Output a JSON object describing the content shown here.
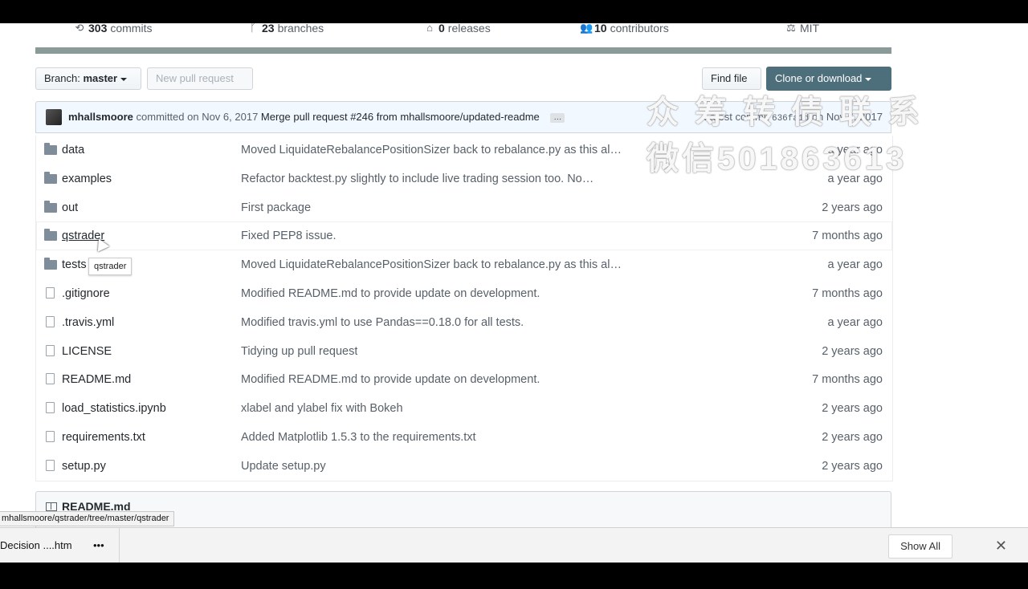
{
  "summary": {
    "commits": {
      "count": "303",
      "label": "commits",
      "icon": "history-icon"
    },
    "branches": {
      "count": "23",
      "label": "branches",
      "icon": "branch-icon"
    },
    "releases": {
      "count": "0",
      "label": "releases",
      "icon": "tag-icon"
    },
    "contributors": {
      "count": "10",
      "label": "contributors",
      "icon": "people-icon"
    },
    "license": {
      "label": "MIT",
      "icon": "law-icon"
    }
  },
  "toolbar": {
    "branch_label": "Branch:",
    "branch_value": "master",
    "new_pull_request": "New pull request",
    "find_file": "Find file",
    "clone_download": "Clone or download"
  },
  "commit": {
    "author": "mhallsmoore",
    "action": "committed on Nov 6, 2017",
    "message": "Merge pull request #246 from mhallsmoore/updated-readme",
    "ellipsis": "…",
    "latest_prefix": "Latest commit",
    "sha": "636fa1d",
    "latest_date": "on Nov 6, 2017"
  },
  "files": [
    {
      "type": "dir",
      "name": "data",
      "message": "Moved LiquidateRebalancePositionSizer back to rebalance.py as this al…",
      "age": "a year ago"
    },
    {
      "type": "dir",
      "name": "examples",
      "message": "Refactor backtest.py slightly to include live trading session too. No…",
      "age": "a year ago"
    },
    {
      "type": "dir",
      "name": "out",
      "message": "First package",
      "age": "2 years ago"
    },
    {
      "type": "dir",
      "name": "qstrader",
      "message": "Fixed PEP8 issue.",
      "age": "7 months ago"
    },
    {
      "type": "dir",
      "name": "tests",
      "message": "Moved LiquidateRebalancePositionSizer back to rebalance.py as this al…",
      "age": "a year ago"
    },
    {
      "type": "file",
      "name": ".gitignore",
      "message": "Modified README.md to provide update on development.",
      "age": "7 months ago"
    },
    {
      "type": "file",
      "name": ".travis.yml",
      "message": "Modified travis.yml to use Pandas==0.18.0 for all tests.",
      "age": "a year ago"
    },
    {
      "type": "file",
      "name": "LICENSE",
      "message": "Tidying up pull request",
      "age": "2 years ago"
    },
    {
      "type": "file",
      "name": "README.md",
      "message": "Modified README.md to provide update on development.",
      "age": "7 months ago"
    },
    {
      "type": "file",
      "name": "load_statistics.ipynb",
      "message": "xlabel and ylabel fix with Bokeh",
      "age": "2 years ago"
    },
    {
      "type": "file",
      "name": "requirements.txt",
      "message": "Added Matplotlib 1.5.3 to the requirements.txt",
      "age": "2 years ago"
    },
    {
      "type": "file",
      "name": "setup.py",
      "message": "Update setup.py",
      "age": "2 years ago"
    }
  ],
  "tooltip": "qstrader",
  "readme": {
    "title": "README.md"
  },
  "status_url": "mhallsmoore/qstrader/tree/master/qstrader",
  "downloads": {
    "item": "Decision ....htm",
    "more": "•••",
    "show_all": "Show All",
    "close": "✕"
  },
  "watermark": {
    "line1": "众筹转债联系",
    "line2": "微信501863613"
  }
}
